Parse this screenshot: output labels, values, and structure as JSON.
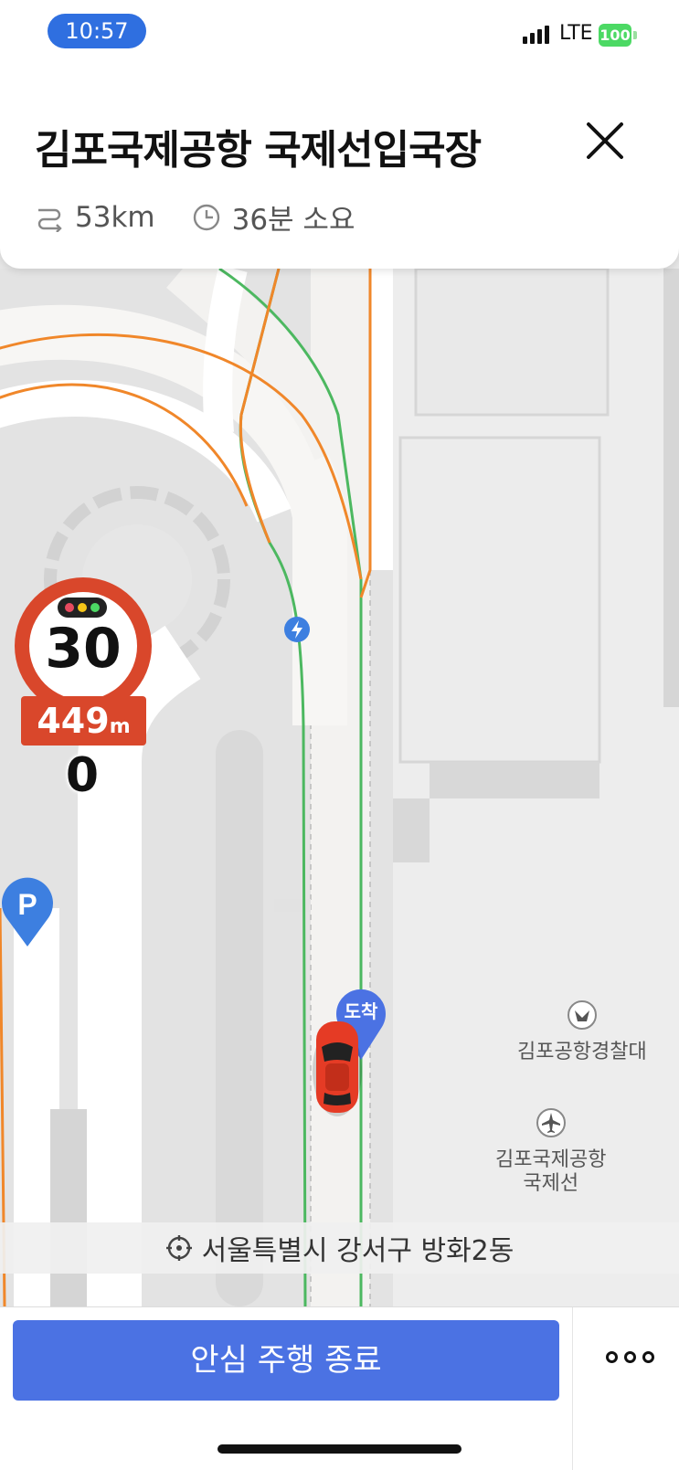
{
  "status_bar": {
    "time": "10:57",
    "network": "LTE",
    "battery": "100"
  },
  "header": {
    "destination": "김포국제공항 국제선입국장",
    "distance": "53km",
    "duration": "36분 소요"
  },
  "map": {
    "speed_limit": "30",
    "camera_distance_value": "449",
    "camera_distance_unit": "m",
    "current_speed": "0",
    "arrival_label": "도착",
    "poi_police": "김포공항경찰대",
    "poi_airport_line1": "김포국제공항",
    "poi_airport_line2": "국제선",
    "address": "서울특별시 강서구 방화2동"
  },
  "bottom": {
    "end_button": "안심 주행 종료"
  },
  "colors": {
    "accent": "#4b72e3",
    "route_green": "#4cb860",
    "route_orange": "#f0872a",
    "speed_red": "#d9472b"
  }
}
